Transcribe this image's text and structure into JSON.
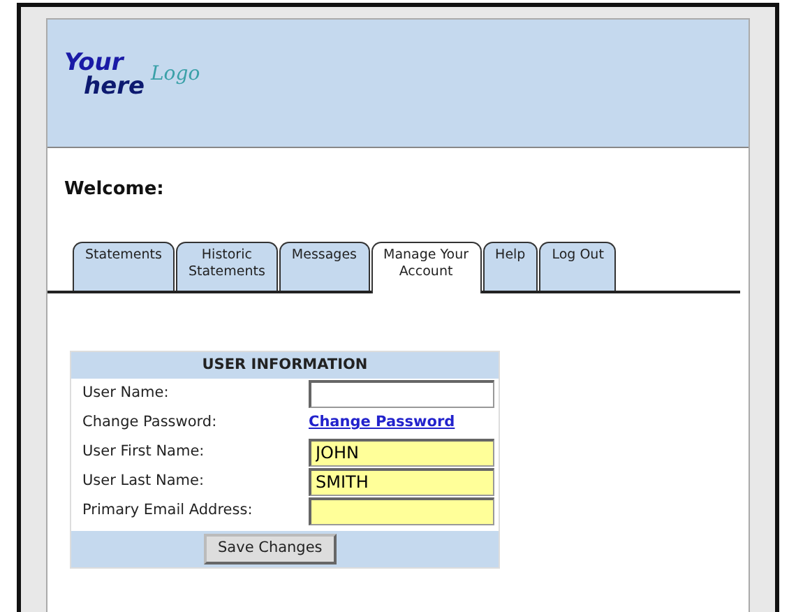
{
  "logo": {
    "top": "Your",
    "bottom": "here",
    "script": "Logo"
  },
  "welcome": "Welcome:",
  "tabs": [
    {
      "label": "Statements",
      "selected": false
    },
    {
      "label": "Historic Statements",
      "selected": false
    },
    {
      "label": "Messages",
      "selected": false
    },
    {
      "label": "Manage Your Account",
      "selected": true
    },
    {
      "label": "Help",
      "selected": false
    },
    {
      "label": "Log Out",
      "selected": false
    }
  ],
  "form": {
    "title": "USER INFORMATION",
    "rows": [
      {
        "label": "User Name:",
        "kind": "input",
        "value": "",
        "highlighted": false
      },
      {
        "label": "Change Password:",
        "kind": "link",
        "link": "Change Password"
      },
      {
        "label": "User First Name:",
        "kind": "input",
        "value": "JOHN",
        "highlighted": true
      },
      {
        "label": "User Last Name:",
        "kind": "input",
        "value": "SMITH",
        "highlighted": true
      },
      {
        "label": "Primary Email Address:",
        "kind": "input",
        "value": "",
        "highlighted": true
      }
    ],
    "button": "Save Changes"
  }
}
